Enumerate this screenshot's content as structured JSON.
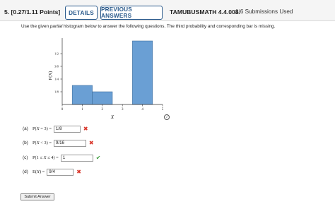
{
  "header": {
    "question_number": "5.  [0.27/1.11 Points]",
    "details_label": "DETAILS",
    "previous_answers_label": "PREVIOUS ANSWERS",
    "question_id": "TAMUBUSMATH 4.4.008.",
    "submissions": "1/6 Submissions Used"
  },
  "instructions": {
    "before": "Use the given ",
    "emphasis": "partial",
    "after": " histogram below to answer the following questions. The third probability and corresponding bar is missing."
  },
  "chart_data": {
    "type": "bar",
    "xlabel": "X",
    "ylabel": "P(X)",
    "x_ticks": [
      "0",
      "1",
      "2",
      "3",
      "4",
      "5"
    ],
    "y_ticks": [
      "1/8",
      "1/4",
      "3/8",
      "1/2"
    ],
    "categories": [
      1,
      2,
      3,
      4
    ],
    "values": [
      0.1875,
      0.125,
      0,
      0.625
    ],
    "ylim": [
      0,
      0.625
    ],
    "xlim": [
      0,
      5
    ],
    "bar_color": "#6a9fd4",
    "grid": false
  },
  "answers": [
    {
      "label": "(a)",
      "expr_pre": "P(",
      "var": "X",
      "expr_post": " = 3) =",
      "value": "1/8",
      "correct": false
    },
    {
      "label": "(b)",
      "expr_pre": "P(",
      "var": "X",
      "expr_post": " < 3) =",
      "value": "9/16",
      "correct": false
    },
    {
      "label": "(c)",
      "expr_pre": "P(1 ≤ ",
      "var": "X",
      "expr_post": " ≤ 4) =",
      "value": "1",
      "correct": true
    },
    {
      "label": "(d)",
      "expr_pre": "E(",
      "var": "X",
      "expr_post": ") =",
      "value": "9/4",
      "correct": false
    }
  ],
  "marks": {
    "wrong": "✖",
    "right": "✔"
  },
  "submit_label": "Submit Answer",
  "info_icon": "i"
}
